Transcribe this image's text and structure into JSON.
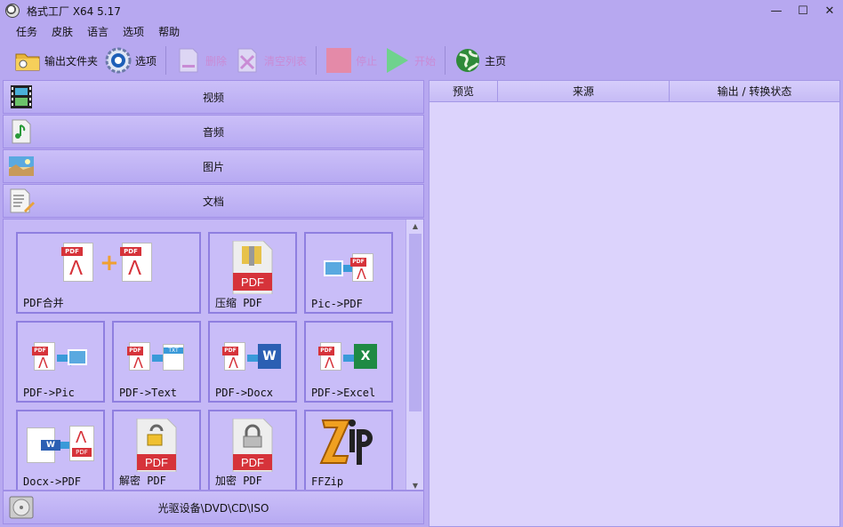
{
  "window": {
    "title": "格式工厂 X64 5.17",
    "minimize": "—",
    "maximize": "☐",
    "close": "✕"
  },
  "menu": [
    "任务",
    "皮肤",
    "语言",
    "选项",
    "帮助"
  ],
  "toolbar": {
    "output_folder": "输出文件夹",
    "options": "选项",
    "remove": "删除",
    "clear_list": "清空列表",
    "stop": "停止",
    "start": "开始",
    "home": "主页"
  },
  "categories": {
    "video": "视频",
    "audio": "音频",
    "image": "图片",
    "document": "文档",
    "rom": "光驱设备\\DVD\\CD\\ISO"
  },
  "tiles": {
    "pdf_merge": "PDF合并",
    "compress_pdf": "压缩 PDF",
    "pic_to_pdf": "Pic->PDF",
    "pdf_to_pic": "PDF->Pic",
    "pdf_to_text": "PDF->Text",
    "pdf_to_docx": "PDF->Docx",
    "pdf_to_excel": "PDF->Excel",
    "docx_to_pdf": "Docx->PDF",
    "decrypt_pdf": "解密 PDF",
    "encrypt_pdf": "加密 PDF",
    "ffzip": "FFZip"
  },
  "badges": {
    "pdf": "PDF",
    "txt": "TXT",
    "w": "W",
    "x": "X"
  },
  "columns": {
    "preview": "预览",
    "source": "来源",
    "output_status": "输出 / 转换状态"
  },
  "colors": {
    "background": "#b7a8f0",
    "pdf_red": "#d6333a",
    "disabled_text": "#c98bd5"
  }
}
